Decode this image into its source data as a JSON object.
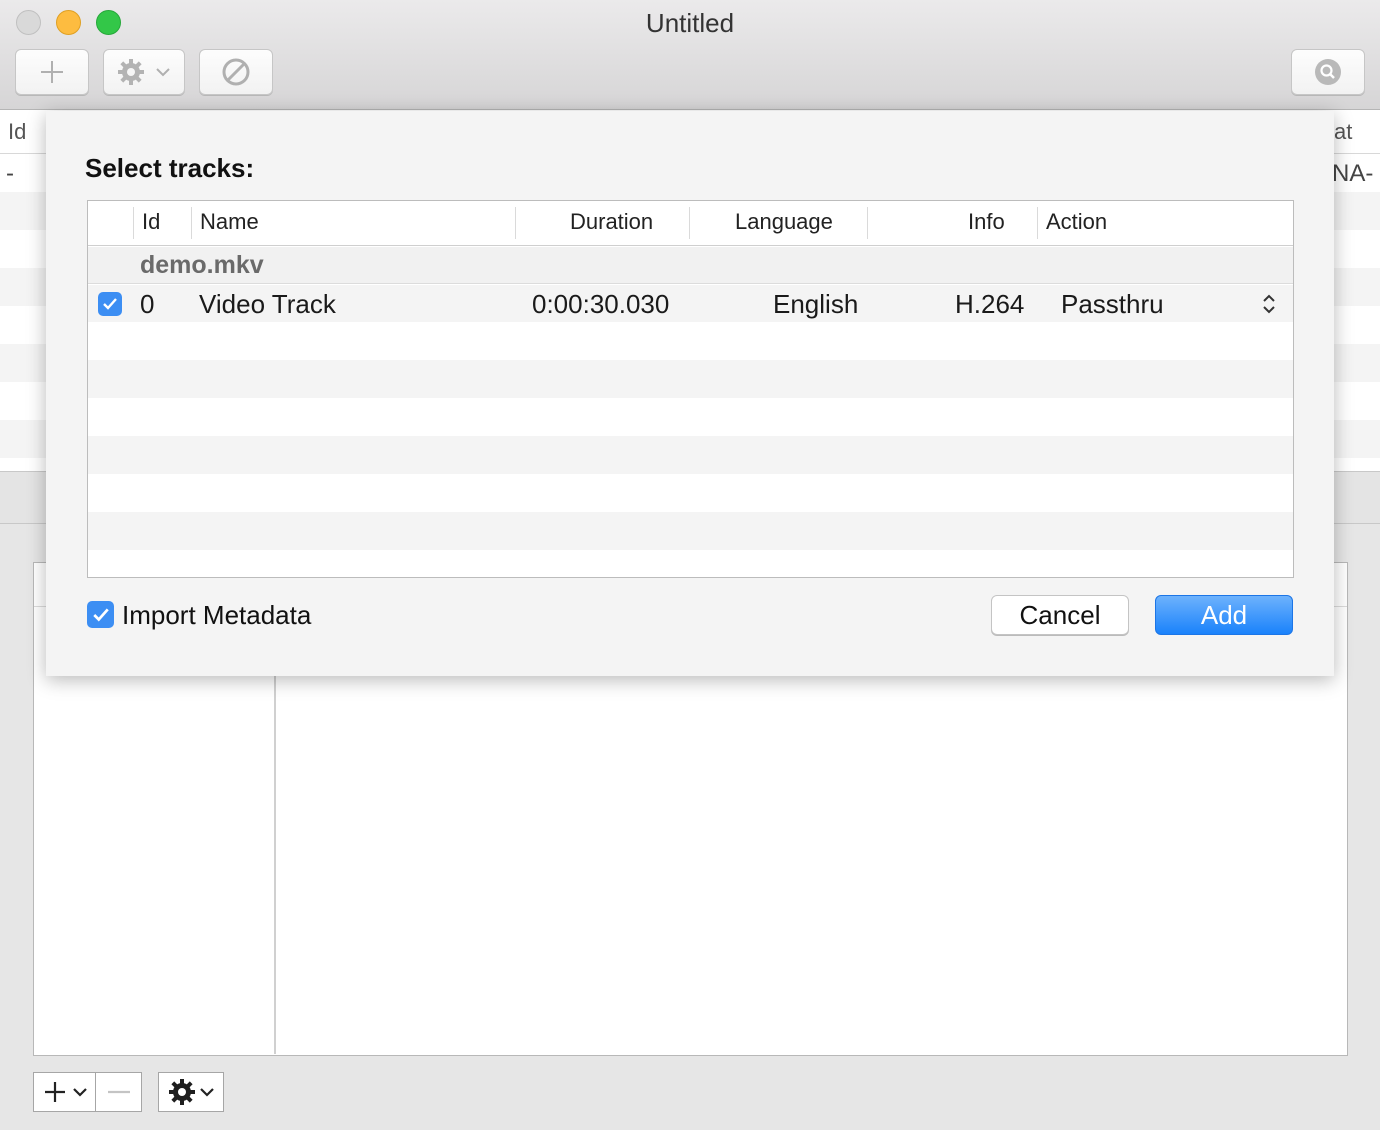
{
  "window": {
    "title": "Untitled"
  },
  "background_table": {
    "col_id": "Id",
    "col_format_fragment": "at",
    "row_id": "-",
    "row_format_fragment": "NA-"
  },
  "sheet": {
    "title": "Select tracks:",
    "columns": {
      "id": "Id",
      "name": "Name",
      "duration": "Duration",
      "language": "Language",
      "info": "Info",
      "action": "Action"
    },
    "group": "demo.mkv",
    "track": {
      "checked": true,
      "id": "0",
      "name": "Video Track",
      "duration": "0:00:30.030",
      "language": "English",
      "info": "H.264",
      "action": "Passthru"
    },
    "import_metadata_label": "Import Metadata",
    "import_metadata_checked": true,
    "cancel_label": "Cancel",
    "add_label": "Add"
  },
  "colors": {
    "accent": "#3c8ef3",
    "add_button_top": "#6db2fc",
    "add_button_bottom": "#1a82fb",
    "traffic_close": "#d9d9d9",
    "traffic_minimize": "#fdbc40",
    "traffic_maximize": "#33c748"
  },
  "icons": {
    "toolbar": [
      "plus-icon",
      "gear-icon",
      "chevron-down-icon",
      "prohibited-icon",
      "search-icon"
    ],
    "bottom": [
      "plus-icon",
      "chevron-down-icon",
      "minus-icon",
      "gear-icon",
      "chevron-down-icon"
    ],
    "row": [
      "checkmark-icon",
      "updown-chevron-icon"
    ]
  }
}
